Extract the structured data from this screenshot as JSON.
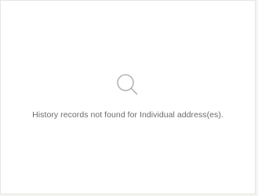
{
  "empty_state": {
    "icon": "search-icon",
    "message": "History records not found for Individual address(es).",
    "icon_color": "#b5b5b5",
    "text_color": "#6b6b6b"
  }
}
